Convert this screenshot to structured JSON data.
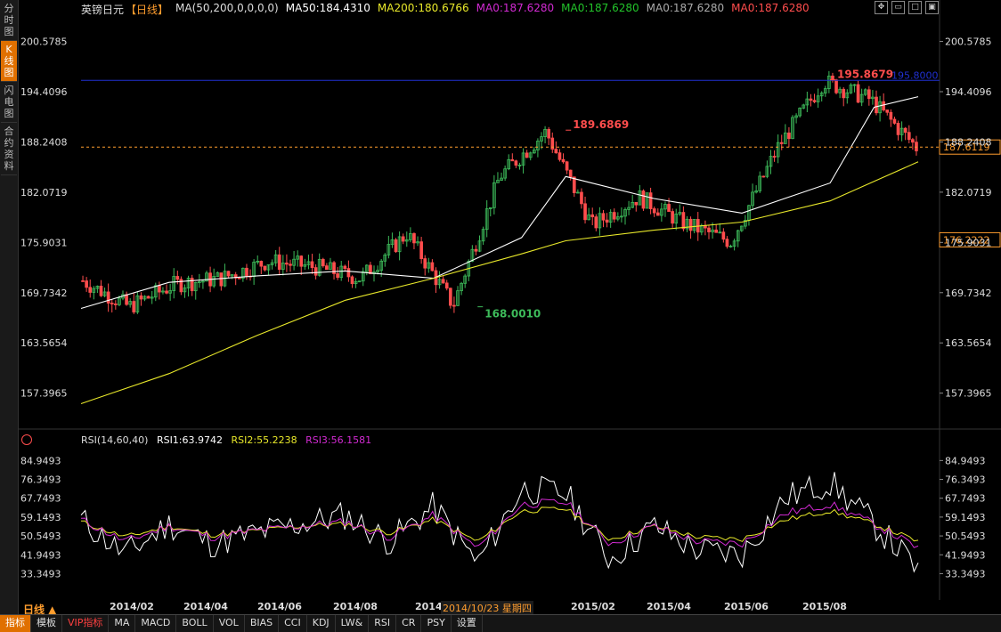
{
  "sidebar": {
    "tabs": [
      {
        "label": "分时图",
        "active": false
      },
      {
        "label": "K线图",
        "active": true
      },
      {
        "label": "闪电图",
        "active": false
      },
      {
        "label": "合约资料",
        "active": false
      }
    ]
  },
  "header": {
    "instrument": "英镑日元",
    "period_tag": "【日线】",
    "ma_params": "MA(50,200,0,0,0,0)",
    "ma50": "MA50:184.4310",
    "ma200": "MA200:180.6766",
    "ma0_a": "MA0:187.6280",
    "ma0_b": "MA0:187.6280",
    "ma0_c": "MA0:187.6280",
    "ma0_d": "MA0:187.6280"
  },
  "rsi_header": {
    "params": "RSI(14,60,40)",
    "rsi1": "RSI1:63.9742",
    "rsi2": "RSI2:55.2238",
    "rsi3": "RSI3:56.1581"
  },
  "price_axis": {
    "ticks": [
      "200.5785",
      "194.4096",
      "188.2408",
      "182.0719",
      "175.9031",
      "169.7342",
      "163.5654",
      "157.3965"
    ],
    "current_price": "187.6119",
    "crosshair_price": "176.2222",
    "hline_label": "195.8000"
  },
  "annotations": {
    "high1": "189.6869",
    "low1": "168.0010",
    "high2": "195.8679"
  },
  "rsi_axis": {
    "ticks": [
      "84.9493",
      "76.3493",
      "67.7493",
      "59.1493",
      "50.5493",
      "41.9493",
      "33.3493"
    ]
  },
  "x_axis": {
    "labels": [
      "2014/02",
      "2014/04",
      "2014/06",
      "2014/08",
      "2014",
      "2015/02",
      "2015/04",
      "2015/06",
      "2015/08"
    ],
    "cursor_date": "2014/10/23 星期四"
  },
  "period_button": "日线 ▲",
  "bottom_tabs": [
    "指标",
    "模板",
    "VIP指标",
    "MA",
    "MACD",
    "BOLL",
    "VOL",
    "BIAS",
    "CCI",
    "KDJ",
    "LW&",
    "RSI",
    "CR",
    "PSY",
    "设置"
  ],
  "colors": {
    "up": "#3dbb5a",
    "down": "#ff4d4d",
    "ma50": "#ffffff",
    "ma200": "#e8e82a",
    "rsi2": "#e8e82a",
    "rsi3": "#d22ad2",
    "hline": "#2030d0",
    "accent": "#e07000"
  },
  "chart_data": [
    {
      "type": "candlestick",
      "title": "英镑日元",
      "x_range": [
        "2014/01",
        "2015/08"
      ],
      "ylim": [
        154.3,
        203.7
      ],
      "series": [
        {
          "name": "MA50",
          "x": [
            "2014/01",
            "2014/03",
            "2014/05",
            "2014/07",
            "2014/09",
            "2014/11",
            "2014/12",
            "2015/02",
            "2015/04",
            "2015/06",
            "2015/07",
            "2015/08"
          ],
          "values": [
            167.8,
            171.0,
            171.8,
            172.4,
            171.5,
            176.5,
            184.0,
            181.3,
            179.5,
            183.2,
            192.5,
            193.8
          ]
        },
        {
          "name": "MA200",
          "x": [
            "2014/01",
            "2014/03",
            "2014/05",
            "2014/07",
            "2014/09",
            "2014/11",
            "2014/12",
            "2015/02",
            "2015/04",
            "2015/06",
            "2015/07",
            "2015/08"
          ],
          "values": [
            156.1,
            159.8,
            164.5,
            168.8,
            171.5,
            174.5,
            176.1,
            177.4,
            178.4,
            181.0,
            183.4,
            185.8
          ]
        }
      ],
      "points": [
        {
          "x": "2014/01",
          "y": 171.2
        },
        {
          "x": "2014/02",
          "y": 168.0
        },
        {
          "x": "2014/03",
          "y": 170.8
        },
        {
          "x": "2014/05",
          "y": 171.5
        },
        {
          "x": "2014/06",
          "y": 173.6
        },
        {
          "x": "2014/07",
          "y": 172.9
        },
        {
          "x": "2014/08",
          "y": 171.5
        },
        {
          "x": "2014/09",
          "y": 177.0
        },
        {
          "x": "2014/10",
          "y": 168.2
        },
        {
          "x": "2014/11",
          "y": 184.0
        },
        {
          "x": "2014/12",
          "y": 189.5
        },
        {
          "x": "2015/01",
          "y": 178.0
        },
        {
          "x": "2015/02",
          "y": 181.5
        },
        {
          "x": "2015/03",
          "y": 178.2
        },
        {
          "x": "2015/04",
          "y": 176.0
        },
        {
          "x": "2015/05",
          "y": 187.5
        },
        {
          "x": "2015/06",
          "y": 195.7
        },
        {
          "x": "2015/07",
          "y": 193.5
        },
        {
          "x": "2015/08",
          "y": 187.6
        }
      ],
      "hline": 195.8
    },
    {
      "type": "line",
      "title": "RSI(14,60,40)",
      "ylim": [
        25.0,
        92.0
      ],
      "x": [
        "2014/01",
        "2014/02",
        "2014/03",
        "2014/04",
        "2014/05",
        "2014/06",
        "2014/07",
        "2014/08",
        "2014/09",
        "2014/10",
        "2014/11",
        "2014/12",
        "2015/01",
        "2015/02",
        "2015/03",
        "2015/04",
        "2015/05",
        "2015/06",
        "2015/07",
        "2015/08"
      ],
      "series": [
        {
          "name": "RSI1",
          "values": [
            58,
            42,
            56,
            47,
            52,
            56,
            60,
            48,
            64,
            38,
            72,
            70,
            40,
            55,
            44,
            42,
            68,
            75,
            56,
            35
          ]
        },
        {
          "name": "RSI2",
          "values": [
            57,
            50,
            55,
            51,
            53,
            55,
            56,
            52,
            58,
            48,
            62,
            63,
            49,
            55,
            50,
            49,
            58,
            62,
            56,
            48
          ]
        },
        {
          "name": "RSI3",
          "values": [
            58,
            48,
            55,
            50,
            53,
            55,
            57,
            50,
            60,
            45,
            65,
            66,
            47,
            55,
            48,
            47,
            61,
            65,
            56,
            45
          ]
        }
      ]
    }
  ]
}
